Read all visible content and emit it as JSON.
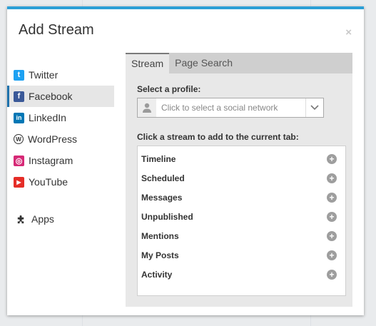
{
  "modal": {
    "title": "Add Stream",
    "close_label": "×"
  },
  "sidebar": {
    "items": [
      {
        "label": "Twitter",
        "icon": "twitter-icon",
        "glyph": "t"
      },
      {
        "label": "Facebook",
        "icon": "facebook-icon",
        "glyph": "f",
        "active": true
      },
      {
        "label": "LinkedIn",
        "icon": "linkedin-icon",
        "glyph": "in"
      },
      {
        "label": "WordPress",
        "icon": "wordpress-icon",
        "glyph": "W"
      },
      {
        "label": "Instagram",
        "icon": "instagram-icon",
        "glyph": "◎"
      },
      {
        "label": "YouTube",
        "icon": "youtube-icon",
        "glyph": "▶"
      }
    ],
    "apps_label": "Apps"
  },
  "tabs": [
    {
      "label": "Stream",
      "active": true
    },
    {
      "label": "Page Search",
      "active": false
    }
  ],
  "profile": {
    "label": "Select a profile:",
    "placeholder": "Click to select a social network"
  },
  "streams": {
    "label": "Click a stream to add to the current tab:",
    "items": [
      "Timeline",
      "Scheduled",
      "Messages",
      "Unpublished",
      "Mentions",
      "My Posts",
      "Activity"
    ]
  },
  "colors": {
    "accent": "#2c9fd6",
    "active_border": "#1f73ad"
  }
}
